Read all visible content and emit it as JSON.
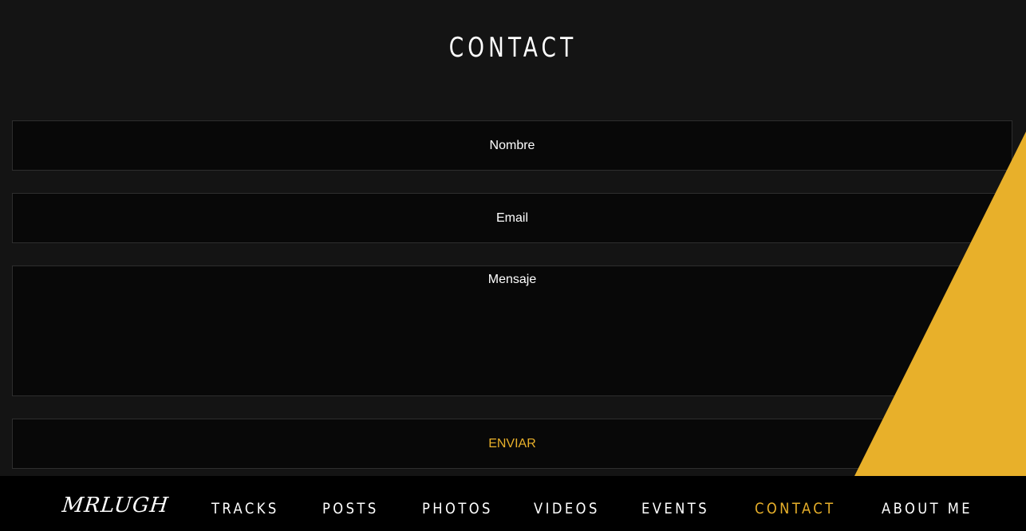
{
  "page": {
    "title": "CONTACT"
  },
  "form": {
    "name_placeholder": "Nombre",
    "email_placeholder": "Email",
    "message_placeholder": "Mensaje",
    "submit_label": "ENVIAR"
  },
  "nav": {
    "logo": "MRLUGH",
    "items": [
      {
        "label": "TRACKS",
        "active": false
      },
      {
        "label": "POSTS",
        "active": false
      },
      {
        "label": "PHOTOS",
        "active": false
      },
      {
        "label": "VIDEOS",
        "active": false
      },
      {
        "label": "EVENTS",
        "active": false
      },
      {
        "label": "CONTACT",
        "active": true
      },
      {
        "label": "ABOUT ME",
        "active": false
      }
    ]
  },
  "colors": {
    "background": "#141414",
    "field_background": "#080808",
    "accent": "#e8b02a",
    "nav_background": "#000000",
    "text": "#ffffff"
  }
}
